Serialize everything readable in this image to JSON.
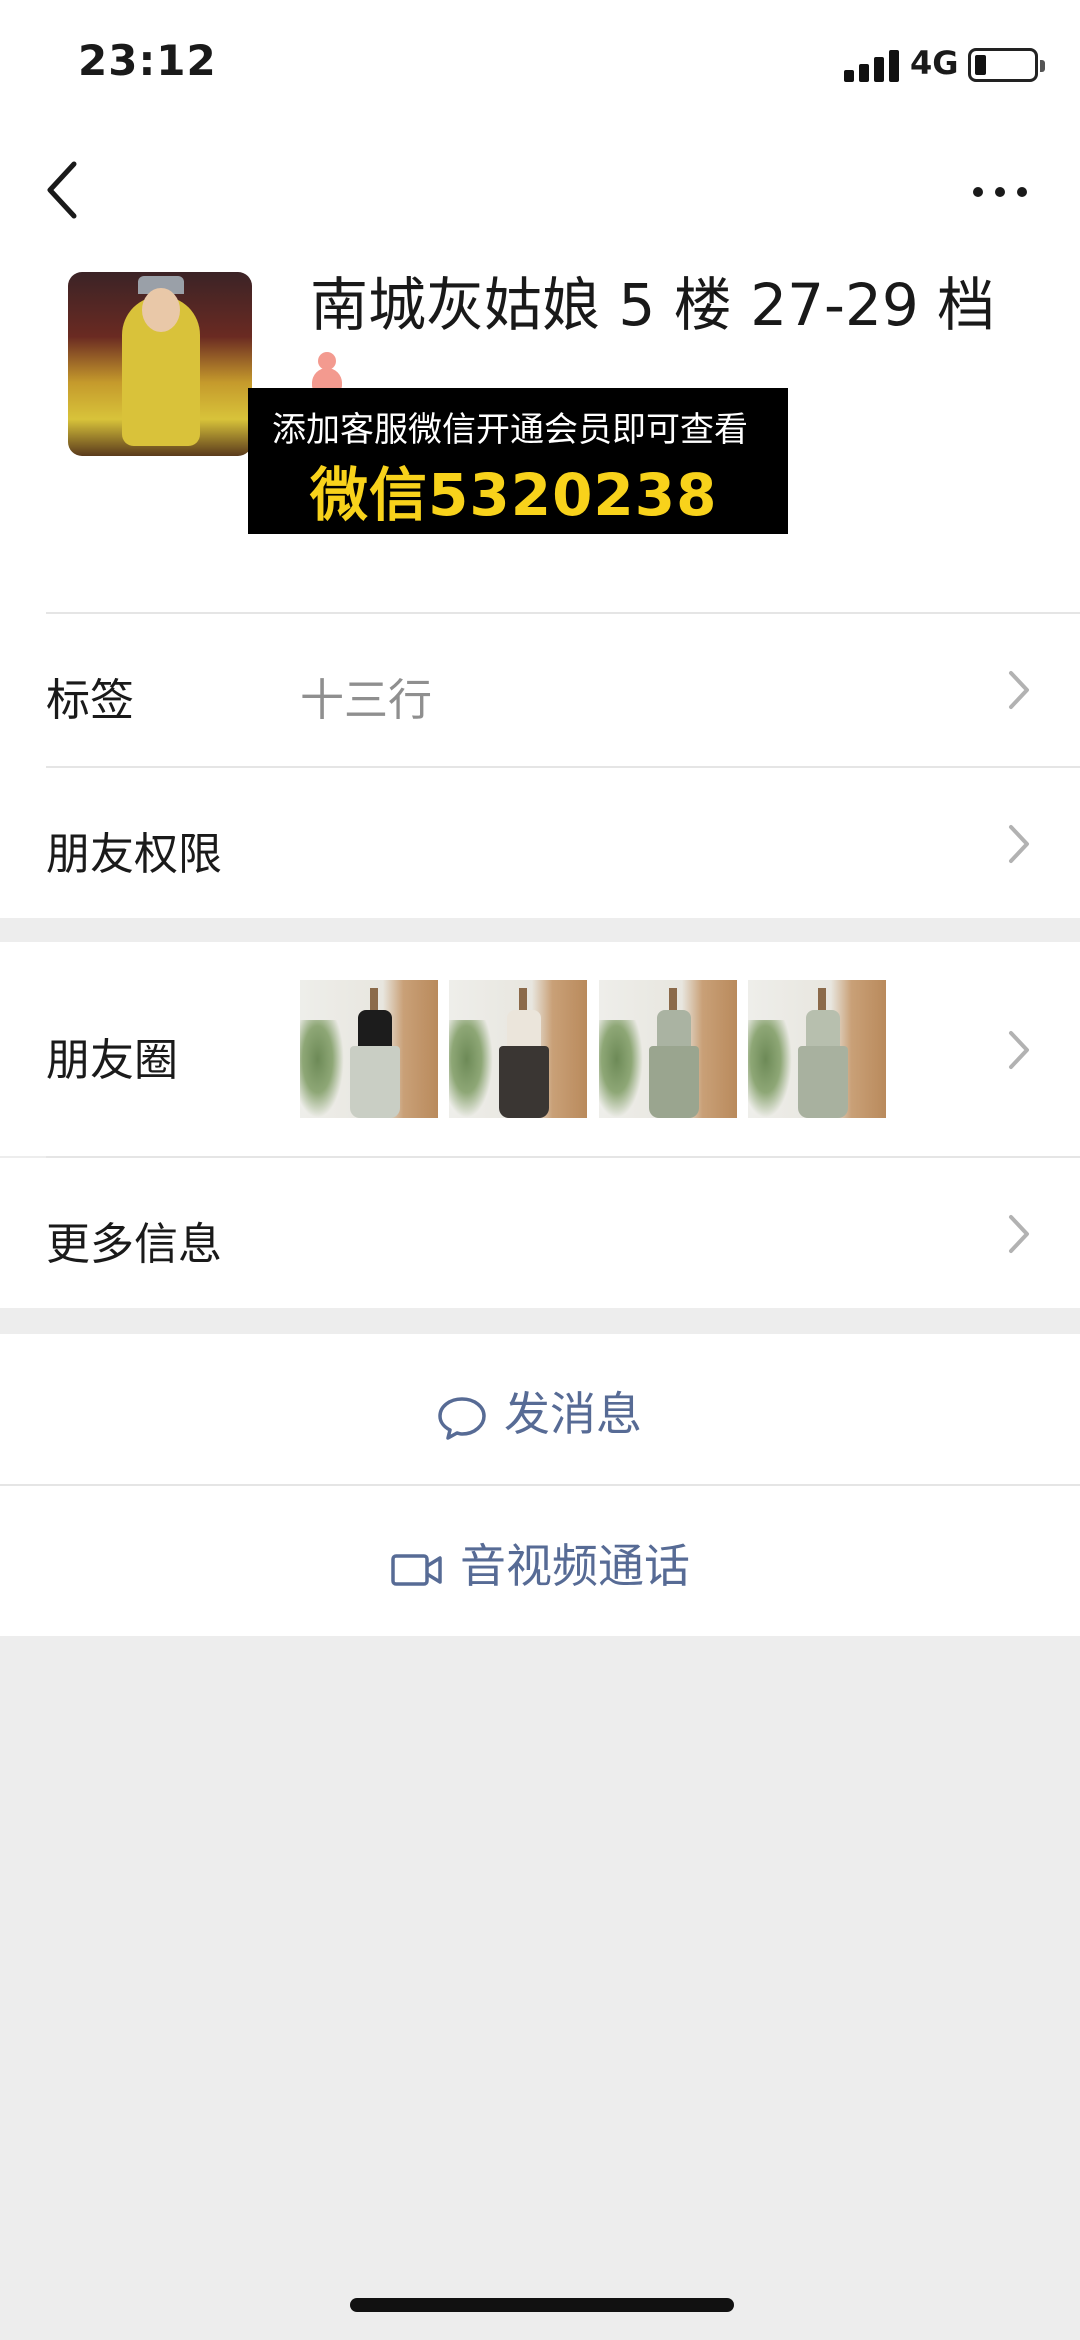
{
  "status_bar": {
    "time": "23:12",
    "network": "4G",
    "battery_level": 0.2
  },
  "nav": {
    "back_icon": "chevron-left-icon",
    "more_icon": "ellipsis-icon"
  },
  "profile": {
    "name": "南城灰姑娘 5 楼 27-29 档",
    "gender_icon": "female-icon",
    "watermark_line1": "添加客服微信开通会员即可查看",
    "watermark_line2": "微信5320238"
  },
  "rows": {
    "tags_label": "标签",
    "tags_value": "十三行",
    "permissions_label": "朋友权限",
    "moments_label": "朋友圈",
    "more_info_label": "更多信息"
  },
  "moments_thumbs": [
    {
      "top_color": "#1c1c1c",
      "skirt_color": "#c9cec4"
    },
    {
      "top_color": "#ebe5db",
      "skirt_color": "#3a3633"
    },
    {
      "top_color": "#aab3a2",
      "skirt_color": "#9aa58f"
    },
    {
      "top_color": "#b7bfae",
      "skirt_color": "#a8b19f"
    }
  ],
  "actions": {
    "message_label": "发消息",
    "message_icon": "chat-bubble-icon",
    "call_label": "音视频通话",
    "call_icon": "video-camera-icon"
  },
  "colors": {
    "link_blue": "#576b95",
    "watermark_yellow": "#f8d21b",
    "page_bg": "#ededed"
  }
}
